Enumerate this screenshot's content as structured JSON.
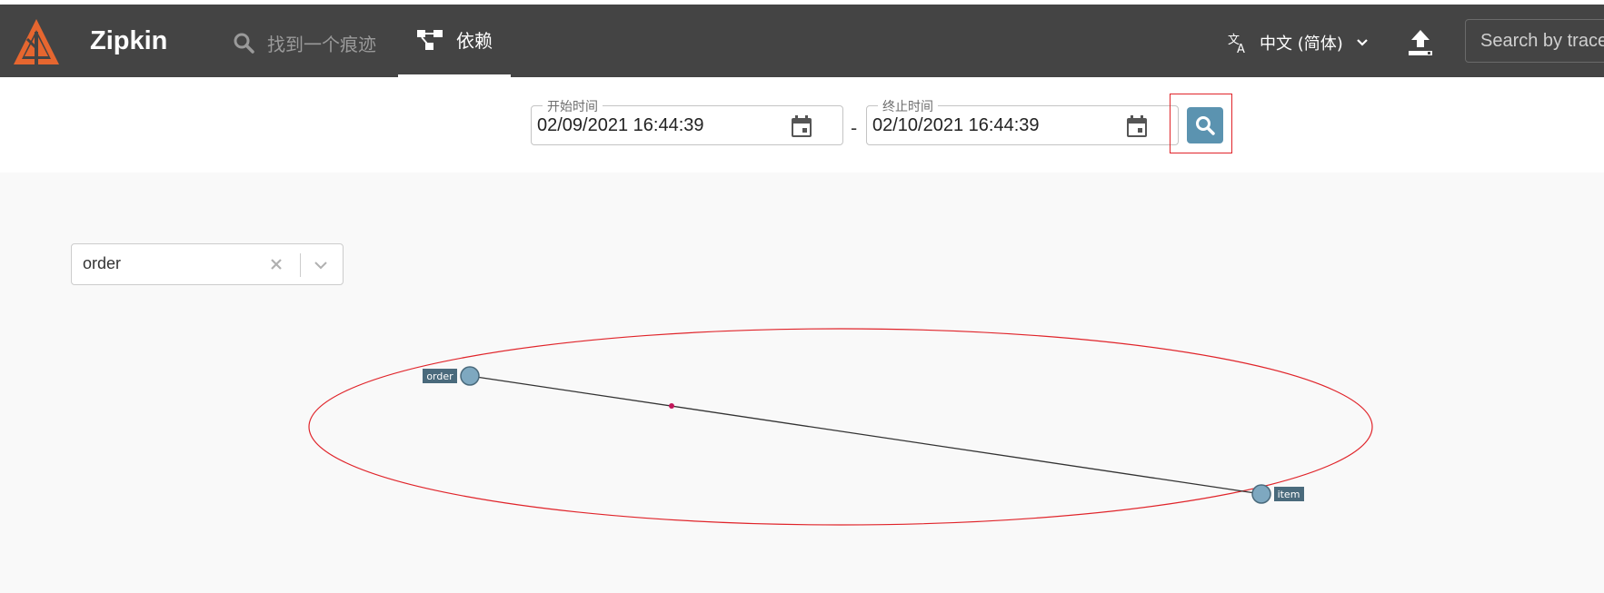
{
  "header": {
    "brand": "Zipkin",
    "nav_find_label": "找到一个痕迹",
    "nav_deps_label": "依赖",
    "language_label": "中文 (简体)",
    "search_placeholder": "Search by trace ID"
  },
  "toolbar": {
    "start_label": "开始时间",
    "start_value": "02/09/2021 16:44:39",
    "end_label": "终止时间",
    "end_value": "02/10/2021 16:44:39",
    "range_separator": "-"
  },
  "filter": {
    "service_value": "order"
  },
  "graph": {
    "nodes": [
      {
        "name": "order"
      },
      {
        "name": "item"
      }
    ],
    "edges": [
      {
        "from": "order",
        "to": "item"
      }
    ]
  },
  "colors": {
    "header_bg": "#444444",
    "accent": "#5b93b0",
    "logo": "#e6662f",
    "highlight": "#e0242a",
    "node_fill": "#7ea8c0",
    "node_label_bg": "#4a6a7c"
  }
}
